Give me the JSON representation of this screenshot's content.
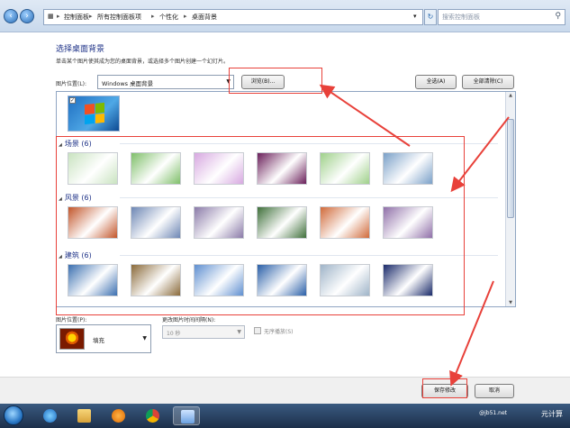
{
  "address_bar": {
    "breadcrumbs": [
      "控制面板",
      "所有控制面板项",
      "个性化",
      "桌面背景"
    ],
    "search_placeholder": "搜索控制面板"
  },
  "main": {
    "title": "选择桌面背景",
    "description": "单击某个图片使其成为您的桌面背景，或选择多个图片创建一个幻灯片。",
    "location_label": "图片位置(L):",
    "location_value": "Windows 桌面背景",
    "browse_button": "浏览(B)...",
    "select_all_button": "全选(A)",
    "clear_all_button": "全部清除(C)"
  },
  "groups": [
    {
      "label": "场景 (6)",
      "colors": [
        "#c9e3c0",
        "#7fbf6a",
        "#d7a8e0",
        "#6a1f5a",
        "#9fd08a",
        "#7aa0c8"
      ]
    },
    {
      "label": "风景 (6)",
      "colors": [
        "#c2552a",
        "#6d86b4",
        "#8a7aa8",
        "#3f6f3a",
        "#d06a3a",
        "#8f6fa8"
      ]
    },
    {
      "label": "建筑 (6)",
      "colors": [
        "#3b6fb0",
        "#8a6a3a",
        "#5f8fd0",
        "#2a5fa8",
        "#9fb4c8",
        "#1a2a6a"
      ]
    }
  ],
  "bottom": {
    "position_label": "图片位置(P):",
    "position_value": "填充",
    "interval_label": "更改图片时间间隔(N):",
    "interval_value": "10 秒",
    "shuffle_label": "无序播放(S)",
    "save_button": "保存修改",
    "cancel_button": "取消"
  },
  "taskbar": {
    "tray_text": "元计算",
    "tray_small": "@jb51.net"
  },
  "colors": {
    "accent_title": "#1e3287",
    "annotation_red": "#e8413a"
  }
}
